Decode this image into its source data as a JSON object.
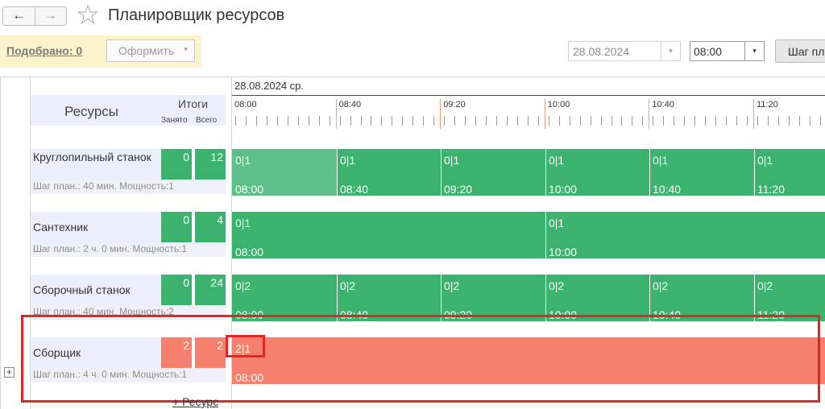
{
  "header": {
    "title": "Планировщик ресурсов",
    "back_glyph": "←",
    "forward_glyph": "→",
    "star_icon": "star-outline-icon"
  },
  "toolbar": {
    "selected_link": "Подобрано: 0",
    "make_button": "Оформить",
    "make_dropdown_glyph": "▾",
    "date_value": "28.08.2024",
    "time_value": "08:00",
    "step_button": "Шаг пл",
    "dropdown_glyph": "▾"
  },
  "columns": {
    "resources": "Ресурсы",
    "totals": "Итоги",
    "busy": "Занято",
    "total": "Всего"
  },
  "scale": {
    "date": "28.08.2024 ср.",
    "ticks": [
      "08:00",
      "08:40",
      "09:20",
      "10:00",
      "10:40",
      "11:20"
    ]
  },
  "resources": [
    {
      "name": "Круглопильный станок",
      "params": "Шаг план.: 40 мин. Мощность:1",
      "busy": "0",
      "total": "12",
      "status": "free",
      "slots": [
        {
          "q": "0|1",
          "t": "08:00"
        },
        {
          "q": "0|1",
          "t": "08:40"
        },
        {
          "q": "0|1",
          "t": "09:20"
        },
        {
          "q": "0|1",
          "t": "10:00"
        },
        {
          "q": "0|1",
          "t": "10:40"
        },
        {
          "q": "0|1",
          "t": "11:20"
        }
      ]
    },
    {
      "name": "Сантехник",
      "params": "Шаг план.: 2 ч. 0 мин. Мощность:1",
      "busy": "0",
      "total": "4",
      "status": "free",
      "slots": [
        {
          "q": "0|1",
          "t": "08:00"
        },
        {
          "q": "0|1",
          "t": "10:00"
        }
      ]
    },
    {
      "name": "Сборочный станок",
      "params": "Шаг план.: 40 мин. Мощность:2",
      "busy": "0",
      "total": "24",
      "status": "free",
      "slots": [
        {
          "q": "0|2",
          "t": "08:00"
        },
        {
          "q": "0|2",
          "t": "08:40"
        },
        {
          "q": "0|2",
          "t": "09:20"
        },
        {
          "q": "0|2",
          "t": "10:00"
        },
        {
          "q": "0|2",
          "t": "10:40"
        },
        {
          "q": "0|2",
          "t": "11:20"
        }
      ]
    },
    {
      "name": "Сборщик",
      "params": "Шаг план.: 4 ч. 0 мин. Мощность:1",
      "busy": "2",
      "total": "2",
      "status": "busy",
      "slots": [
        {
          "q": "2|1",
          "t": "08:00"
        }
      ]
    }
  ],
  "footer": {
    "expand_glyph": "+",
    "add_resource": "+ Ресурс"
  },
  "colors": {
    "free": "#3bb36e",
    "busy": "#f4806d",
    "highlight": "#e02727",
    "selection_panel": "#fbf3cc"
  }
}
